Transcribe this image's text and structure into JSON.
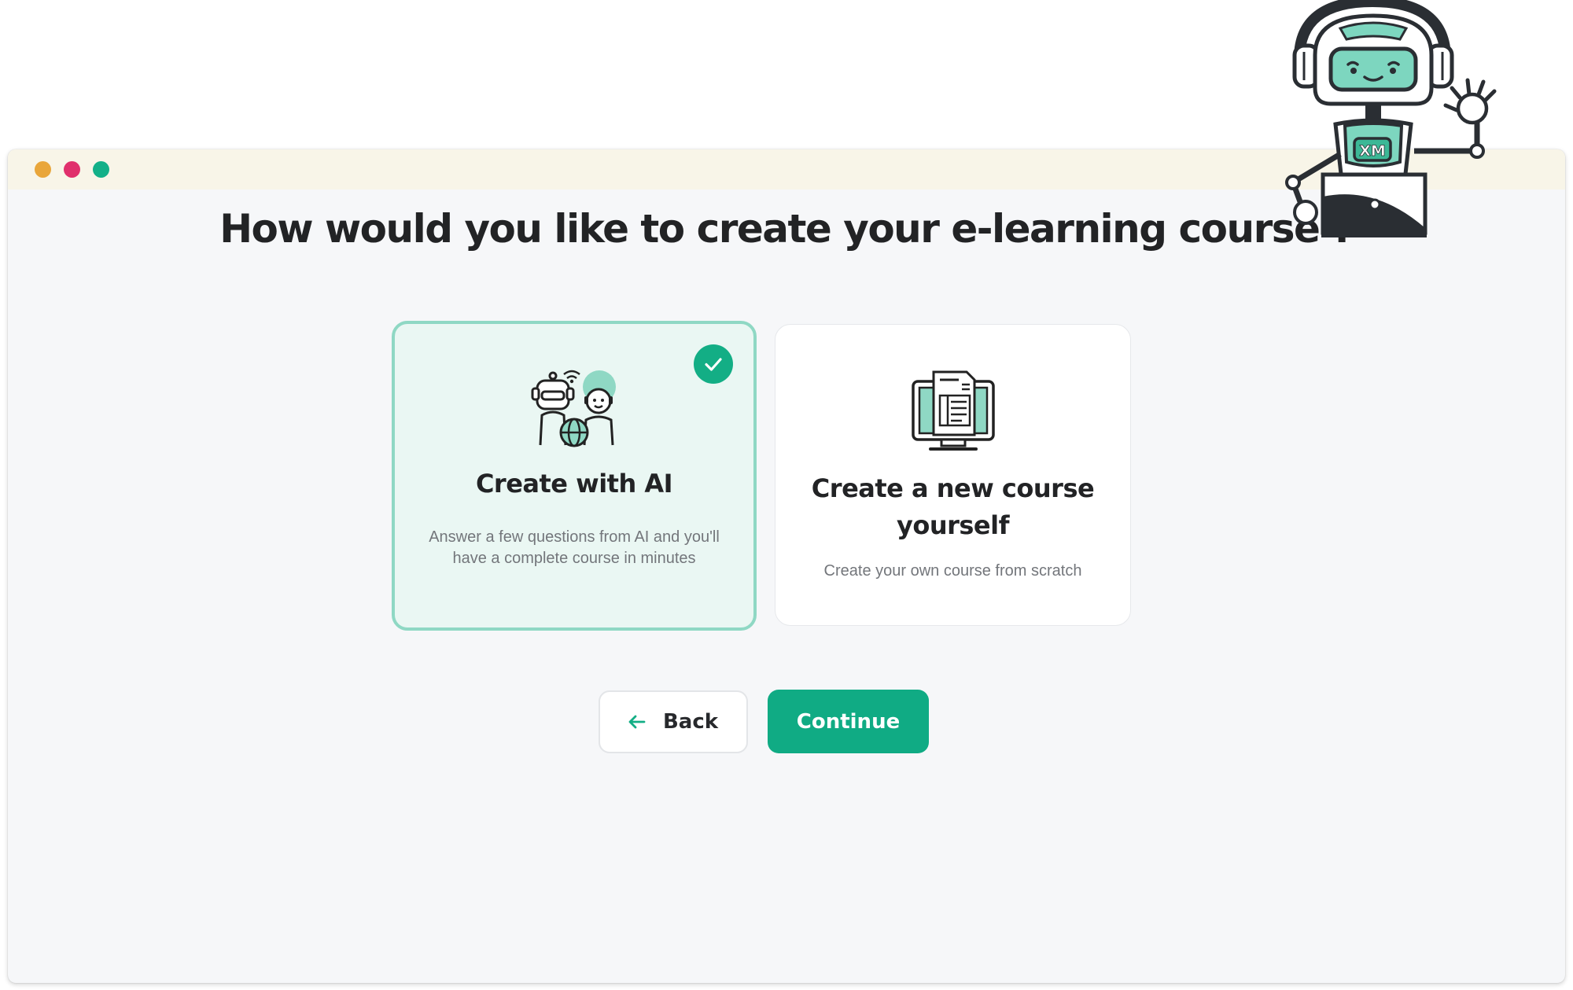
{
  "window": {
    "controls": [
      "window-close-dot",
      "window-minimize-dot",
      "window-maximize-dot"
    ]
  },
  "main": {
    "heading": "How would you like to create your e-learning course ?"
  },
  "options": [
    {
      "title": "Create with AI",
      "description": "Answer a few questions from AI and you'll have a complete course in minutes",
      "icon": "robot-and-person-icon",
      "selected": true
    },
    {
      "title": "Create a new course yourself",
      "description": "Create your own course from scratch",
      "icon": "computer-course-icon",
      "selected": false
    }
  ],
  "actions": {
    "back_label": "Back",
    "continue_label": "Continue"
  },
  "mascot": {
    "badge_text": "XM",
    "icon": "robot-mascot-icon"
  },
  "colors": {
    "accent": "#10ab84",
    "selected_border": "#8fd8c4",
    "selected_bg": "#eaf7f3",
    "titlebar": "#f8f5e8",
    "dot_orange": "#e9a63a",
    "dot_pink": "#e0306c",
    "dot_green": "#13b088",
    "heading_text": "#222325",
    "muted_text": "#73767b"
  }
}
